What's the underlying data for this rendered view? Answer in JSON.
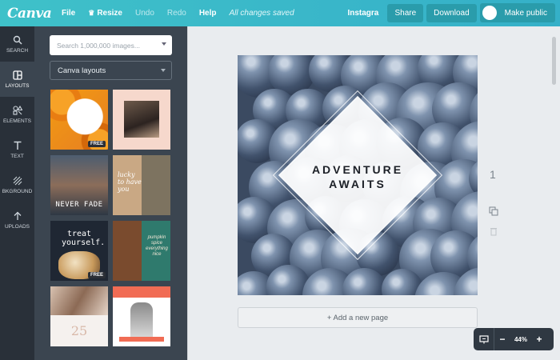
{
  "topbar": {
    "logo": "Canva",
    "file_label": "File",
    "resize_label": "Resize",
    "undo_label": "Undo",
    "redo_label": "Redo",
    "help_label": "Help",
    "save_status": "All changes saved",
    "doc_title": "Instagra...",
    "share_label": "Share",
    "download_label": "Download",
    "make_public_label": "Make public"
  },
  "leftnav": {
    "items": [
      {
        "label": "SEARCH",
        "icon": "search-icon"
      },
      {
        "label": "LAYOUTS",
        "icon": "layouts-icon"
      },
      {
        "label": "ELEMENTS",
        "icon": "elements-icon"
      },
      {
        "label": "TEXT",
        "icon": "text-icon"
      },
      {
        "label": "BKGROUND",
        "icon": "background-icon"
      },
      {
        "label": "UPLOADS",
        "icon": "uploads-icon"
      }
    ],
    "active": "LAYOUTS"
  },
  "panel": {
    "search_placeholder": "Search 1,000,000 images...",
    "layout_select": "Canva layouts",
    "thumb_free_badge": "FREE",
    "thumb_texts": {
      "never_fade": "NEVER FADE",
      "lucky": "lucky to have you",
      "treat": "treat yourself.",
      "pumpkin": "pumpkin spice everything nice",
      "date": "25"
    }
  },
  "canvas": {
    "headline_line1": "ADVENTURE",
    "headline_line2": "AWAITS",
    "page_number": "1",
    "add_page_label": "+ Add a new page"
  },
  "zoom": {
    "minus": "−",
    "value": "44%",
    "plus": "+"
  },
  "colors": {
    "topbar": "#3fc1c9",
    "nav_bg": "#293039",
    "panel_bg": "#3b4550",
    "workspace_bg": "#e9ecef"
  }
}
